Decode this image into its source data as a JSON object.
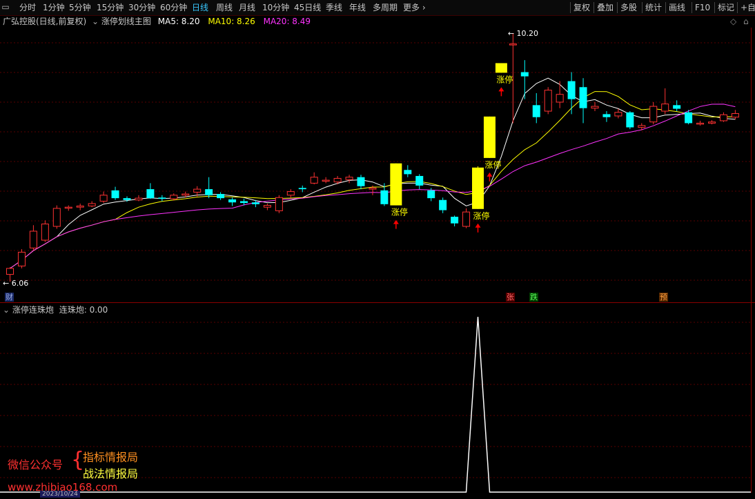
{
  "toolbar": {
    "left": [
      {
        "label": "分时"
      },
      {
        "label": "1分钟"
      },
      {
        "label": "5分钟"
      },
      {
        "label": "15分钟"
      },
      {
        "label": "30分钟"
      },
      {
        "label": "60分钟"
      },
      {
        "label": "日线",
        "active": true
      },
      {
        "label": "周线"
      },
      {
        "label": "月线"
      },
      {
        "label": "10分钟"
      },
      {
        "label": "45日线"
      },
      {
        "label": "季线"
      },
      {
        "label": "年线"
      },
      {
        "label": "多周期"
      },
      {
        "label": "更多"
      }
    ],
    "right": [
      {
        "label": "复权"
      },
      {
        "label": "叠加"
      },
      {
        "label": "多股"
      },
      {
        "label": "统计"
      },
      {
        "label": "画线"
      },
      {
        "label": "F10"
      },
      {
        "label": "标记"
      },
      {
        "label": "+自选"
      }
    ],
    "more_chevron": "›"
  },
  "main_header": {
    "stock": "广弘控股(日线,前复权)",
    "indicator": "涨停划线主图",
    "ma5_label": "MA5: 8.20",
    "ma10_label": "MA10: 8.26",
    "ma20_label": "MA20: 8.49",
    "ma5_color": "#ffffff",
    "ma10_color": "#ffff00",
    "ma20_color": "#ff33ff"
  },
  "main_chart": {
    "high_label": "10.20",
    "low_label": "6.06",
    "limit_up_label": "涨停",
    "badges": {
      "cai": "财",
      "zhang": "张",
      "die": "跌",
      "yu": "预"
    },
    "colors": {
      "up": "#ff3232",
      "down": "#00ffff",
      "limit": "#ffff00",
      "arrow": "#ff0000"
    }
  },
  "sub_header": {
    "title": "涨停连珠炮",
    "value_label": "连珠炮: 0.00"
  },
  "chart_data": {
    "type": "candlestick",
    "candles": [
      {
        "o": 6.18,
        "c": 6.28,
        "h": 6.3,
        "l": 6.06
      },
      {
        "o": 6.32,
        "c": 6.55,
        "h": 6.6,
        "l": 6.28
      },
      {
        "o": 6.62,
        "c": 6.9,
        "h": 7.0,
        "l": 6.58
      },
      {
        "o": 6.75,
        "c": 7.02,
        "h": 7.08,
        "l": 6.72
      },
      {
        "o": 6.98,
        "c": 7.28,
        "h": 7.33,
        "l": 6.94
      },
      {
        "o": 7.3,
        "c": 7.3,
        "h": 7.33,
        "l": 7.24
      },
      {
        "o": 7.3,
        "c": 7.32,
        "h": 7.36,
        "l": 7.25
      },
      {
        "o": 7.32,
        "c": 7.36,
        "h": 7.4,
        "l": 7.3
      },
      {
        "o": 7.4,
        "c": 7.5,
        "h": 7.56,
        "l": 7.37
      },
      {
        "o": 7.58,
        "c": 7.45,
        "h": 7.64,
        "l": 7.42
      },
      {
        "o": 7.45,
        "c": 7.42,
        "h": 7.48,
        "l": 7.39
      },
      {
        "o": 7.42,
        "c": 7.45,
        "h": 7.5,
        "l": 7.4
      },
      {
        "o": 7.6,
        "c": 7.45,
        "h": 7.7,
        "l": 7.44
      },
      {
        "o": 7.46,
        "c": 7.44,
        "h": 7.5,
        "l": 7.4
      },
      {
        "o": 7.44,
        "c": 7.5,
        "h": 7.53,
        "l": 7.41
      },
      {
        "o": 7.5,
        "c": 7.52,
        "h": 7.56,
        "l": 7.46
      },
      {
        "o": 7.55,
        "c": 7.6,
        "h": 7.65,
        "l": 7.48
      },
      {
        "o": 7.6,
        "c": 7.5,
        "h": 7.8,
        "l": 7.45
      },
      {
        "o": 7.52,
        "c": 7.45,
        "h": 7.55,
        "l": 7.42
      },
      {
        "o": 7.43,
        "c": 7.38,
        "h": 7.46,
        "l": 7.32
      },
      {
        "o": 7.4,
        "c": 7.37,
        "h": 7.44,
        "l": 7.33
      },
      {
        "o": 7.38,
        "c": 7.35,
        "h": 7.42,
        "l": 7.3
      },
      {
        "o": 7.3,
        "c": 7.33,
        "h": 7.36,
        "l": 7.25
      },
      {
        "o": 7.24,
        "c": 7.46,
        "h": 7.5,
        "l": 7.2
      },
      {
        "o": 7.5,
        "c": 7.56,
        "h": 7.6,
        "l": 7.46
      },
      {
        "o": 7.62,
        "c": 7.6,
        "h": 7.66,
        "l": 7.55
      },
      {
        "o": 7.7,
        "c": 7.8,
        "h": 7.88,
        "l": 7.68
      },
      {
        "o": 7.75,
        "c": 7.75,
        "h": 7.8,
        "l": 7.7
      },
      {
        "o": 7.72,
        "c": 7.78,
        "h": 7.82,
        "l": 7.68
      },
      {
        "o": 7.76,
        "c": 7.8,
        "h": 7.84,
        "l": 7.7
      },
      {
        "o": 7.8,
        "c": 7.65,
        "h": 7.84,
        "l": 7.6
      },
      {
        "o": 7.6,
        "c": 7.62,
        "h": 7.66,
        "l": 7.5
      },
      {
        "o": 7.58,
        "c": 7.35,
        "h": 7.7,
        "l": 7.32
      },
      {
        "o": 7.33,
        "c": 8.03,
        "h": 8.03,
        "l": 7.33,
        "limit": true
      },
      {
        "o": 7.92,
        "c": 7.85,
        "h": 8.0,
        "l": 7.8
      },
      {
        "o": 7.82,
        "c": 7.66,
        "h": 7.85,
        "l": 7.6
      },
      {
        "o": 7.58,
        "c": 7.45,
        "h": 7.62,
        "l": 7.4
      },
      {
        "o": 7.42,
        "c": 7.25,
        "h": 7.46,
        "l": 7.2
      },
      {
        "o": 7.14,
        "c": 7.03,
        "h": 7.16,
        "l": 6.98
      },
      {
        "o": 6.98,
        "c": 7.22,
        "h": 7.28,
        "l": 6.95
      },
      {
        "o": 7.27,
        "c": 7.96,
        "h": 7.98,
        "l": 7.27,
        "limit": true
      },
      {
        "o": 8.12,
        "c": 8.81,
        "h": 8.81,
        "l": 8.12,
        "limit": true
      },
      {
        "o": 9.54,
        "c": 9.7,
        "h": 9.7,
        "l": 9.54,
        "limit": true
      },
      {
        "o": 10.02,
        "c": 10.02,
        "h": 10.2,
        "l": 8.7
      },
      {
        "o": 9.55,
        "c": 9.48,
        "h": 9.75,
        "l": 9.1
      },
      {
        "o": 9.0,
        "c": 8.8,
        "h": 9.2,
        "l": 8.7
      },
      {
        "o": 8.9,
        "c": 9.25,
        "h": 9.3,
        "l": 8.85
      },
      {
        "o": 9.05,
        "c": 9.18,
        "h": 9.4,
        "l": 8.95
      },
      {
        "o": 9.4,
        "c": 9.1,
        "h": 9.55,
        "l": 8.85
      },
      {
        "o": 9.3,
        "c": 8.95,
        "h": 9.45,
        "l": 8.7
      },
      {
        "o": 8.95,
        "c": 8.98,
        "h": 9.05,
        "l": 8.9
      },
      {
        "o": 8.85,
        "c": 8.8,
        "h": 8.9,
        "l": 8.72
      },
      {
        "o": 8.82,
        "c": 8.88,
        "h": 8.94,
        "l": 8.78
      },
      {
        "o": 8.88,
        "c": 8.63,
        "h": 8.9,
        "l": 8.6
      },
      {
        "o": 8.63,
        "c": 8.66,
        "h": 8.7,
        "l": 8.58
      },
      {
        "o": 8.72,
        "c": 8.98,
        "h": 9.05,
        "l": 8.68
      },
      {
        "o": 8.9,
        "c": 9.02,
        "h": 9.28,
        "l": 8.85
      },
      {
        "o": 9.0,
        "c": 8.94,
        "h": 9.08,
        "l": 8.9
      },
      {
        "o": 8.88,
        "c": 8.7,
        "h": 8.92,
        "l": 8.68
      },
      {
        "o": 8.69,
        "c": 8.7,
        "h": 8.74,
        "l": 8.66
      },
      {
        "o": 8.7,
        "c": 8.72,
        "h": 8.75,
        "l": 8.68
      },
      {
        "o": 8.74,
        "c": 8.84,
        "h": 8.88,
        "l": 8.72
      },
      {
        "o": 8.8,
        "c": 8.86,
        "h": 8.92,
        "l": 8.76
      }
    ],
    "limit_marker_indices": [
      33,
      40,
      41,
      42
    ],
    "sub_series": {
      "name": "连珠炮",
      "peak_index": 40,
      "peak_value": 1,
      "baseline": 0
    }
  },
  "watermark": {
    "line1_left": "微信公众号",
    "line1_right": "指标情报局",
    "line2_right": "战法情报局",
    "line3": "www.zhibiao168.com",
    "date_strip": "2023/10/24"
  }
}
